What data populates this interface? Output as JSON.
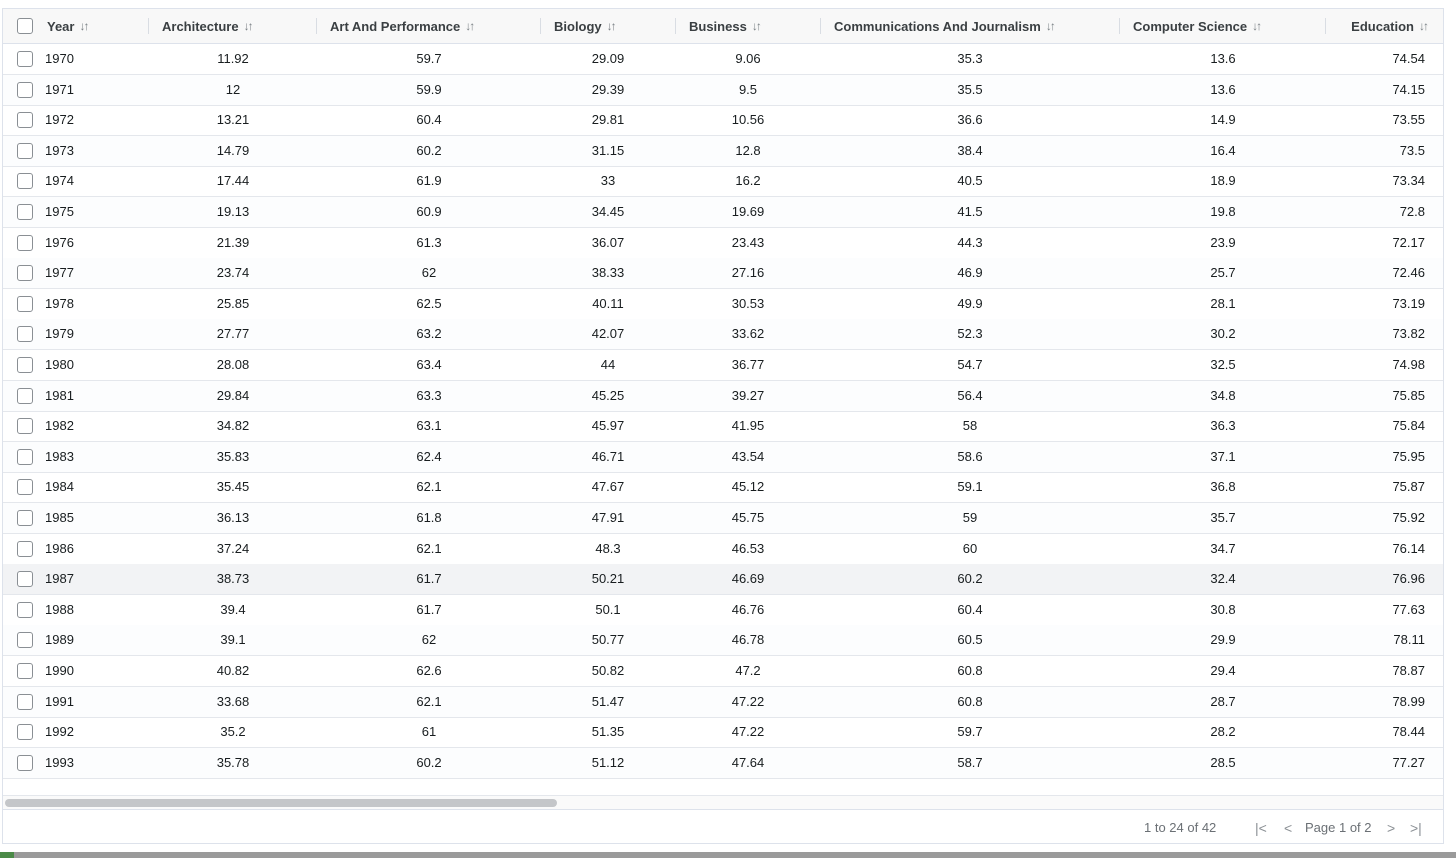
{
  "table": {
    "columns": [
      {
        "label": "Year",
        "sort_icon": "↓↑"
      },
      {
        "label": "Architecture",
        "sort_icon": "↓↑"
      },
      {
        "label": "Art And Performance",
        "sort_icon": "↓↑"
      },
      {
        "label": "Biology",
        "sort_icon": "↓↑"
      },
      {
        "label": "Business",
        "sort_icon": "↓↑"
      },
      {
        "label": "Communications And Journalism",
        "sort_icon": "↓↑"
      },
      {
        "label": "Computer Science",
        "sort_icon": "↓↑"
      },
      {
        "label": "Education",
        "sort_icon": "↓↑"
      }
    ],
    "rows": [
      [
        "1970",
        "11.92",
        "59.7",
        "29.09",
        "9.06",
        "35.3",
        "13.6",
        "74.54"
      ],
      [
        "1971",
        "12",
        "59.9",
        "29.39",
        "9.5",
        "35.5",
        "13.6",
        "74.15"
      ],
      [
        "1972",
        "13.21",
        "60.4",
        "29.81",
        "10.56",
        "36.6",
        "14.9",
        "73.55"
      ],
      [
        "1973",
        "14.79",
        "60.2",
        "31.15",
        "12.8",
        "38.4",
        "16.4",
        "73.5"
      ],
      [
        "1974",
        "17.44",
        "61.9",
        "33",
        "16.2",
        "40.5",
        "18.9",
        "73.34"
      ],
      [
        "1975",
        "19.13",
        "60.9",
        "34.45",
        "19.69",
        "41.5",
        "19.8",
        "72.8"
      ],
      [
        "1976",
        "21.39",
        "61.3",
        "36.07",
        "23.43",
        "44.3",
        "23.9",
        "72.17"
      ],
      [
        "1977",
        "23.74",
        "62",
        "38.33",
        "27.16",
        "46.9",
        "25.7",
        "72.46"
      ],
      [
        "1978",
        "25.85",
        "62.5",
        "40.11",
        "30.53",
        "49.9",
        "28.1",
        "73.19"
      ],
      [
        "1979",
        "27.77",
        "63.2",
        "42.07",
        "33.62",
        "52.3",
        "30.2",
        "73.82"
      ],
      [
        "1980",
        "28.08",
        "63.4",
        "44",
        "36.77",
        "54.7",
        "32.5",
        "74.98"
      ],
      [
        "1981",
        "29.84",
        "63.3",
        "45.25",
        "39.27",
        "56.4",
        "34.8",
        "75.85"
      ],
      [
        "1982",
        "34.82",
        "63.1",
        "45.97",
        "41.95",
        "58",
        "36.3",
        "75.84"
      ],
      [
        "1983",
        "35.83",
        "62.4",
        "46.71",
        "43.54",
        "58.6",
        "37.1",
        "75.95"
      ],
      [
        "1984",
        "35.45",
        "62.1",
        "47.67",
        "45.12",
        "59.1",
        "36.8",
        "75.87"
      ],
      [
        "1985",
        "36.13",
        "61.8",
        "47.91",
        "45.75",
        "59",
        "35.7",
        "75.92"
      ],
      [
        "1986",
        "37.24",
        "62.1",
        "48.3",
        "46.53",
        "60",
        "34.7",
        "76.14"
      ],
      [
        "1987",
        "38.73",
        "61.7",
        "50.21",
        "46.69",
        "60.2",
        "32.4",
        "76.96"
      ],
      [
        "1988",
        "39.4",
        "61.7",
        "50.1",
        "46.76",
        "60.4",
        "30.8",
        "77.63"
      ],
      [
        "1989",
        "39.1",
        "62",
        "50.77",
        "46.78",
        "60.5",
        "29.9",
        "78.11"
      ],
      [
        "1990",
        "40.82",
        "62.6",
        "50.82",
        "47.2",
        "60.8",
        "29.4",
        "78.87"
      ],
      [
        "1991",
        "33.68",
        "62.1",
        "51.47",
        "47.22",
        "60.8",
        "28.7",
        "78.99"
      ],
      [
        "1992",
        "35.2",
        "61",
        "51.35",
        "47.22",
        "59.7",
        "28.2",
        "78.44"
      ],
      [
        "1993",
        "35.78",
        "60.2",
        "51.12",
        "47.64",
        "58.7",
        "28.5",
        "77.27"
      ]
    ],
    "hovered_row": "1987"
  },
  "pagination": {
    "summary": "1 to 24 of 42",
    "page_label": "Page 1 of 2",
    "first_icon": "|<",
    "prev_icon": "<",
    "next_icon": ">",
    "last_icon": ">|"
  }
}
